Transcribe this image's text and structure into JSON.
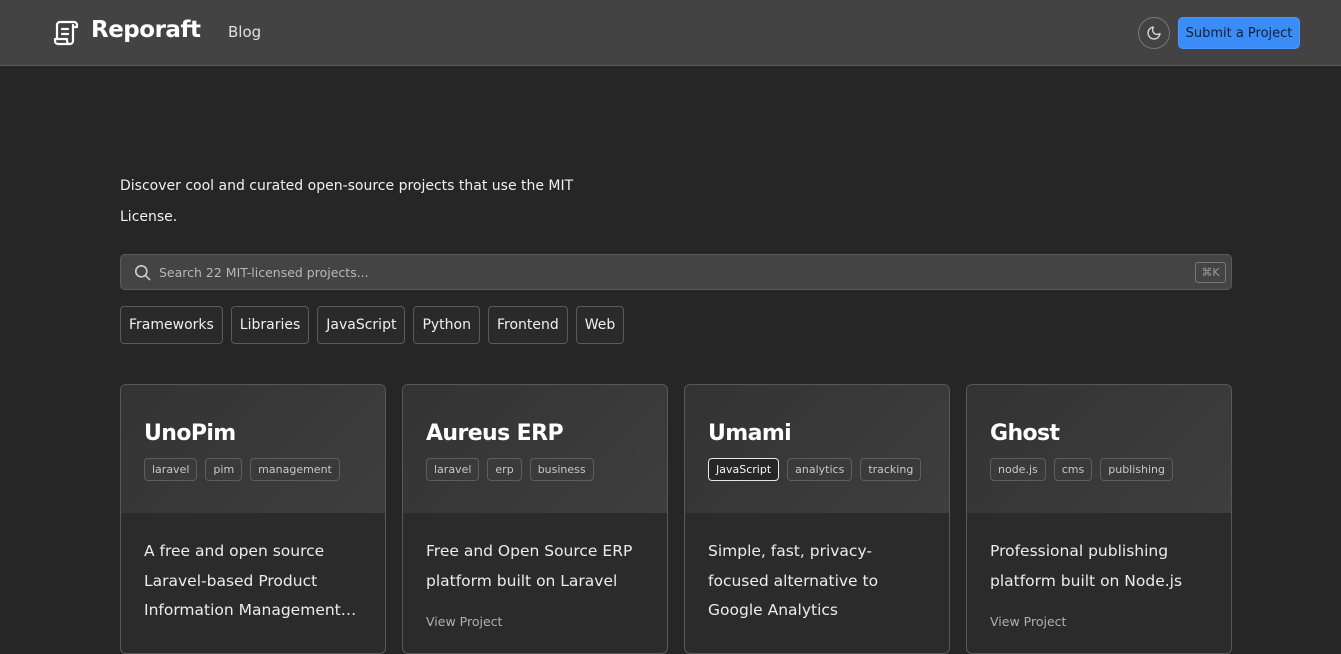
{
  "nav": {
    "brand": "Reporaft",
    "blog": "Blog",
    "submit": "Submit a Project",
    "theme_icon": "moon-icon",
    "logo_icon": "scroll-icon"
  },
  "intro": "Discover cool and curated open-source projects that use the MIT License.",
  "search": {
    "placeholder": "Search 22 MIT-licensed projects...",
    "shortcut": "⌘K"
  },
  "filters": [
    "Frameworks",
    "Libraries",
    "JavaScript",
    "Python",
    "Frontend",
    "Web"
  ],
  "cards": [
    {
      "title": "UnoPim",
      "tags": [
        "laravel",
        "pim",
        "management"
      ],
      "description": "A free and open source Laravel-based Product Information Management…",
      "link": ""
    },
    {
      "title": "Aureus ERP",
      "tags": [
        "laravel",
        "erp",
        "business"
      ],
      "description": "Free and Open Source ERP platform built on Laravel",
      "link": "View Project"
    },
    {
      "title": "Umami",
      "tags": [
        "JavaScript",
        "analytics",
        "tracking"
      ],
      "active_tag": "JavaScript",
      "description": "Simple, fast, privacy-focused alternative to Google Analytics",
      "link": ""
    },
    {
      "title": "Ghost",
      "tags": [
        "node.js",
        "cms",
        "publishing"
      ],
      "description": "Professional publishing platform built on Node.js",
      "link": "View Project"
    }
  ],
  "colors": {
    "background": "#262626",
    "navbar": "#434343",
    "accent": "#3b8cf6"
  }
}
